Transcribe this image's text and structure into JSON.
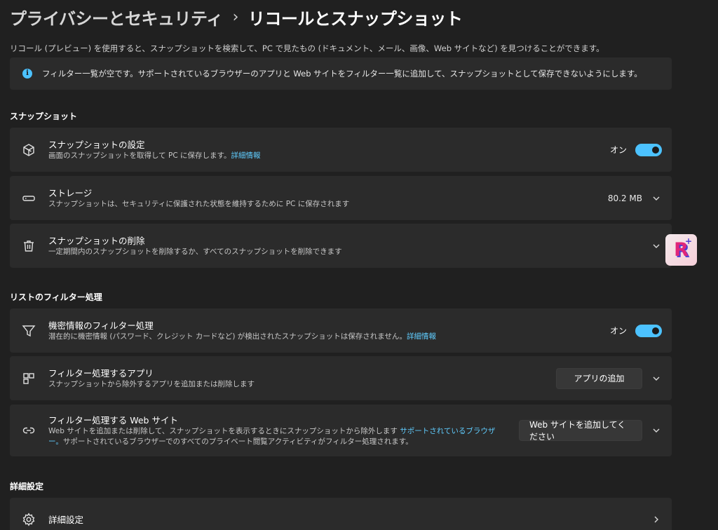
{
  "breadcrumb": {
    "parent": "プライバシーとセキュリティ",
    "separator": "›",
    "current": "リコールとスナップショット"
  },
  "description": "リコール (プレビュー) を使用すると、スナップショットを検索して、PC で見たもの (ドキュメント、メール、画像、Web サイトなど) を見つけることができます。",
  "info_bar": {
    "icon": "info-icon",
    "text": "フィルター一覧が空です。サポートされているブラウザーのアプリと Web サイトをフィルター一覧に追加して、スナップショットとして保存できないようにします。"
  },
  "sections": {
    "snapshots": "スナップショット",
    "filter_lists": "リストのフィルター処理",
    "advanced": "詳細設定"
  },
  "snapshot_settings": {
    "icon": "snapshot-cube-icon",
    "title": "スナップショットの設定",
    "subtitle": "画面のスナップショットを取得して PC に保存します。",
    "link": "詳細情報",
    "toggle_label": "オン",
    "toggle_on": true
  },
  "storage": {
    "icon": "storage-drive-icon",
    "title": "ストレージ",
    "subtitle": "スナップショットは、セキュリティに保護された状態を維持するために PC に保存されます",
    "value": "80.2 MB"
  },
  "delete_snapshots": {
    "icon": "trash-icon",
    "title": "スナップショットの削除",
    "subtitle": "一定期間内のスナップショットを削除するか、すべてのスナップショットを削除できます"
  },
  "sensitive_filter": {
    "icon": "filter-funnel-icon",
    "title": "機密情報のフィルター処理",
    "subtitle": "潜在的に機密情報 (パスワード、クレジット カードなど) が検出されたスナップショットは保存されません。",
    "link": "詳細情報",
    "toggle_label": "オン",
    "toggle_on": true
  },
  "filter_apps": {
    "icon": "apps-grid-icon",
    "title": "フィルター処理するアプリ",
    "subtitle": "スナップショットから除外するアプリを追加または削除します",
    "button": "アプリの追加"
  },
  "filter_websites": {
    "icon": "link-icon",
    "title": "フィルター処理する Web サイト",
    "subtitle_before": "Web サイトを追加または削除して、スナップショットを表示するときにスナップショットから除外します",
    "link": "サポートされているブラウザー。",
    "subtitle_after": "サポートされているブラウザーでのすべてのプライベート閲覧アクティビティがフィルター処理されます。",
    "button": "Web サイトを追加してください"
  },
  "advanced_settings": {
    "icon": "gear-icon",
    "title": "詳細設定"
  },
  "floating_badge": {
    "letter": "R",
    "plus": "+"
  },
  "colors": {
    "background": "#202020",
    "card": "#2b2b2b",
    "accent": "#4cc2ff",
    "link": "#60cdff"
  }
}
